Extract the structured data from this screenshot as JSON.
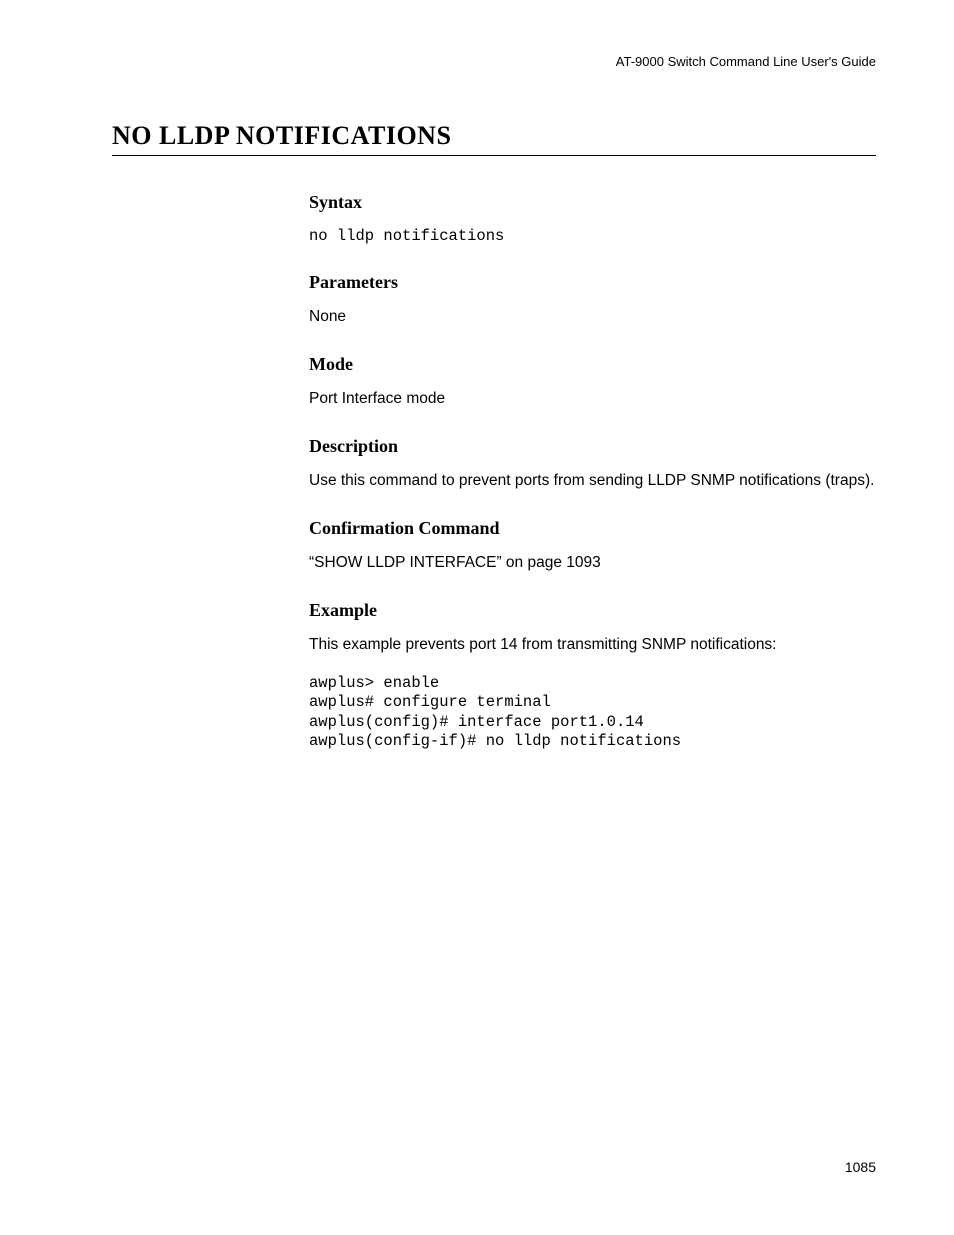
{
  "header": {
    "running": "AT-9000 Switch Command Line User's Guide"
  },
  "title": "NO LLDP NOTIFICATIONS",
  "sections": {
    "syntax": {
      "heading": "Syntax",
      "code": "no lldp notifications"
    },
    "parameters": {
      "heading": "Parameters",
      "text": "None"
    },
    "mode": {
      "heading": "Mode",
      "text": "Port Interface mode"
    },
    "description": {
      "heading": "Description",
      "text": "Use this command to prevent ports from sending LLDP SNMP notifications (traps)."
    },
    "confirmation": {
      "heading": "Confirmation Command",
      "text": "“SHOW LLDP INTERFACE” on page 1093"
    },
    "example": {
      "heading": "Example",
      "intro": "This example prevents port 14 from transmitting SNMP notifications:",
      "code": "awplus> enable\nawplus# configure terminal\nawplus(config)# interface port1.0.14\nawplus(config-if)# no lldp notifications"
    }
  },
  "page_number": "1085"
}
